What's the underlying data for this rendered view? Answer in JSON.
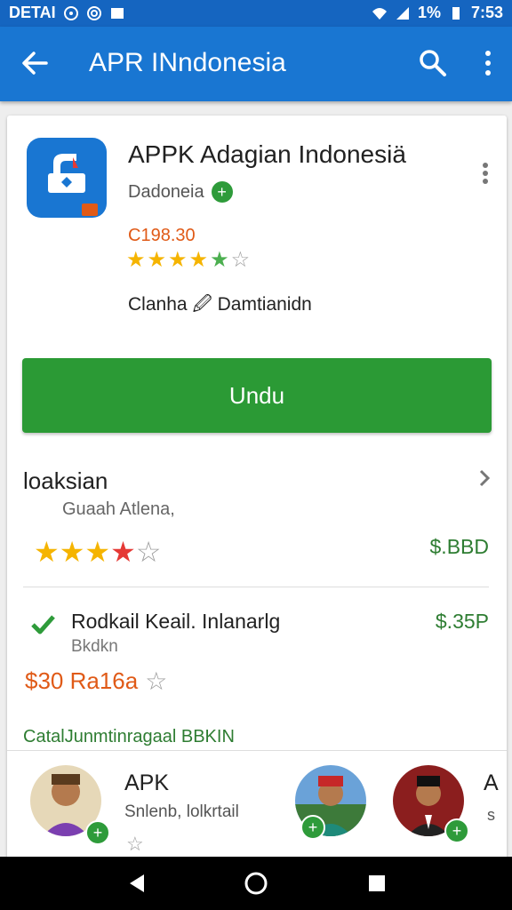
{
  "status_bar": {
    "carrier": "DETAI",
    "battery": "1%",
    "time": "7:53"
  },
  "app_bar": {
    "title": "APR INndonesia"
  },
  "app": {
    "title": "APPK Adagian Indonesiä",
    "developer": "Dadonеiа",
    "price": "C198.30",
    "rating": 4.5,
    "description": "Clanha 🖉 Damtianidn",
    "install_label": "Undu"
  },
  "section1": {
    "title": "loaksian",
    "subtitle": "Guaah Atlena,",
    "rating": 3.5,
    "price": "$.BBD"
  },
  "section2": {
    "title": "Rodkail Keail. Inlanarlg",
    "price": "$.35P",
    "subtitle": "Bkdkn",
    "rating_text": "$30 Ra16a"
  },
  "section3": {
    "title": "CatalJunmtinragaal BBKIN"
  },
  "bottom_item": {
    "title": "APK",
    "subtitle": "Snlenb, lolkrtail",
    "cut_title": "A",
    "cut_sub": "s"
  },
  "colors": {
    "status_bar": "#1565c0",
    "app_bar": "#1976d2",
    "install": "#2b9a35",
    "price_orange": "#e05a17",
    "price_green": "#2e7d32"
  },
  "icons": [
    "back-arrow-icon",
    "search-icon",
    "more-vert-icon",
    "verified-icon",
    "star-icon",
    "chevron-right-icon",
    "check-icon",
    "nav-back-icon",
    "nav-home-icon",
    "nav-recents-icon"
  ]
}
